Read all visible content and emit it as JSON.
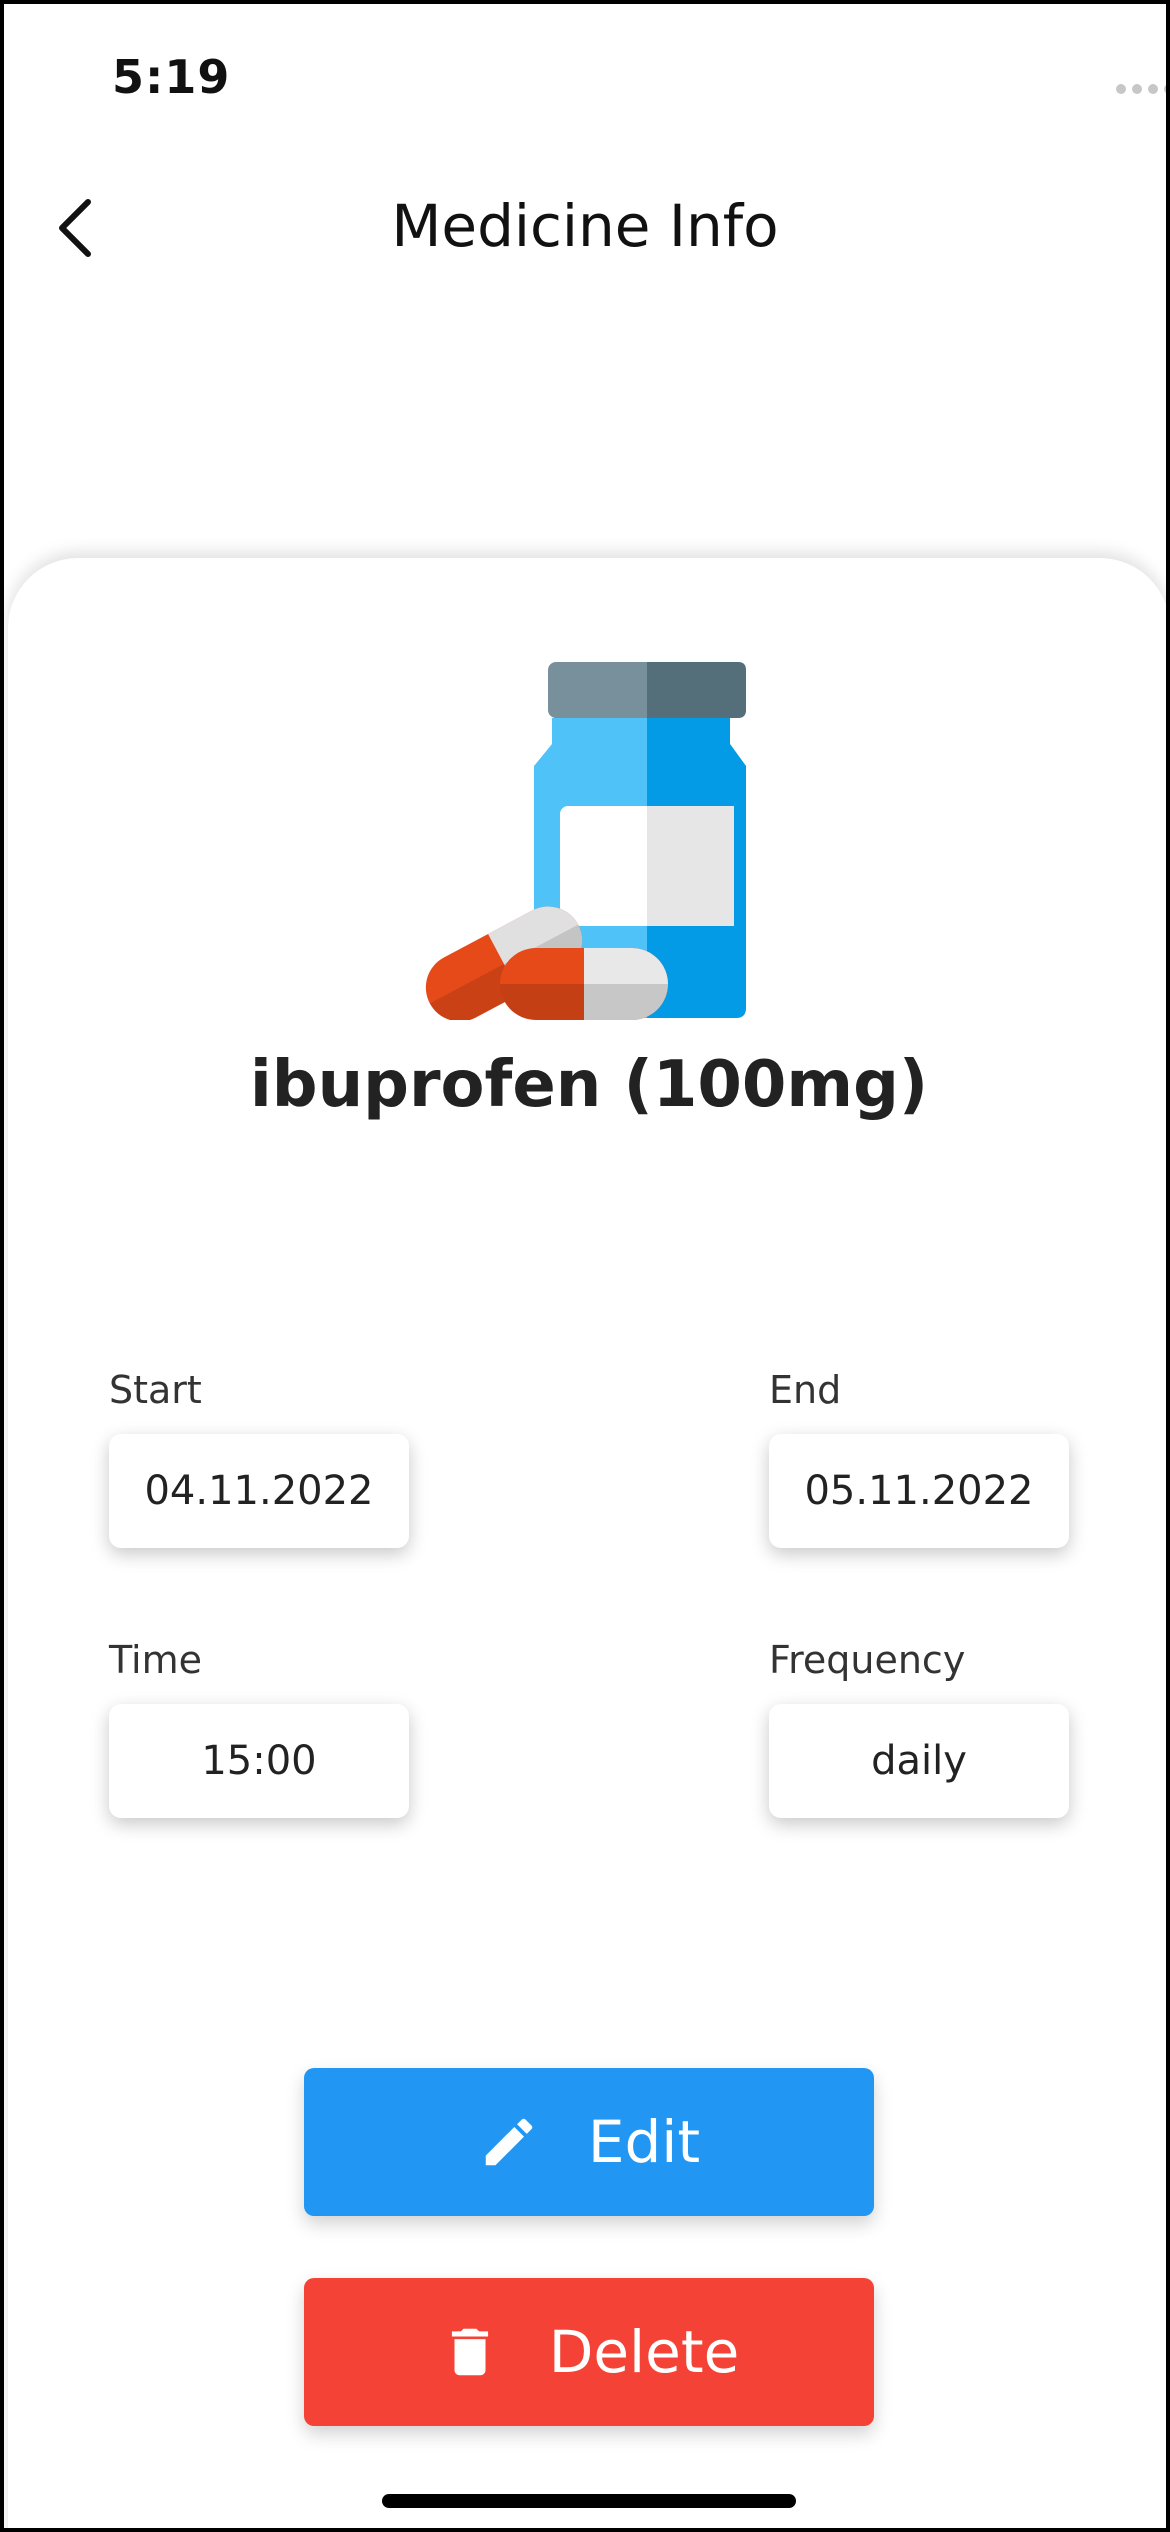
{
  "status_bar": {
    "time": "5:19"
  },
  "header": {
    "title": "Medicine Info",
    "back_icon": "chevron-left-icon"
  },
  "medicine": {
    "name": "ibuprofen (100mg)",
    "image": "medicine-bottle-and-pills-icon"
  },
  "fields": {
    "start": {
      "label": "Start",
      "value": "04.11.2022"
    },
    "end": {
      "label": "End",
      "value": "05.11.2022"
    },
    "time": {
      "label": "Time",
      "value": "15:00"
    },
    "frequency": {
      "label": "Frequency",
      "value": "daily"
    }
  },
  "actions": {
    "edit": {
      "label": "Edit",
      "icon": "pencil-icon",
      "color": "#2196f3"
    },
    "delete": {
      "label": "Delete",
      "icon": "trash-icon",
      "color": "#f44336"
    }
  },
  "colors": {
    "bottle": "#4fc3f7",
    "bottle_shade": "#039be5",
    "cap": "#78909c",
    "pill_red": "#e64a19"
  }
}
